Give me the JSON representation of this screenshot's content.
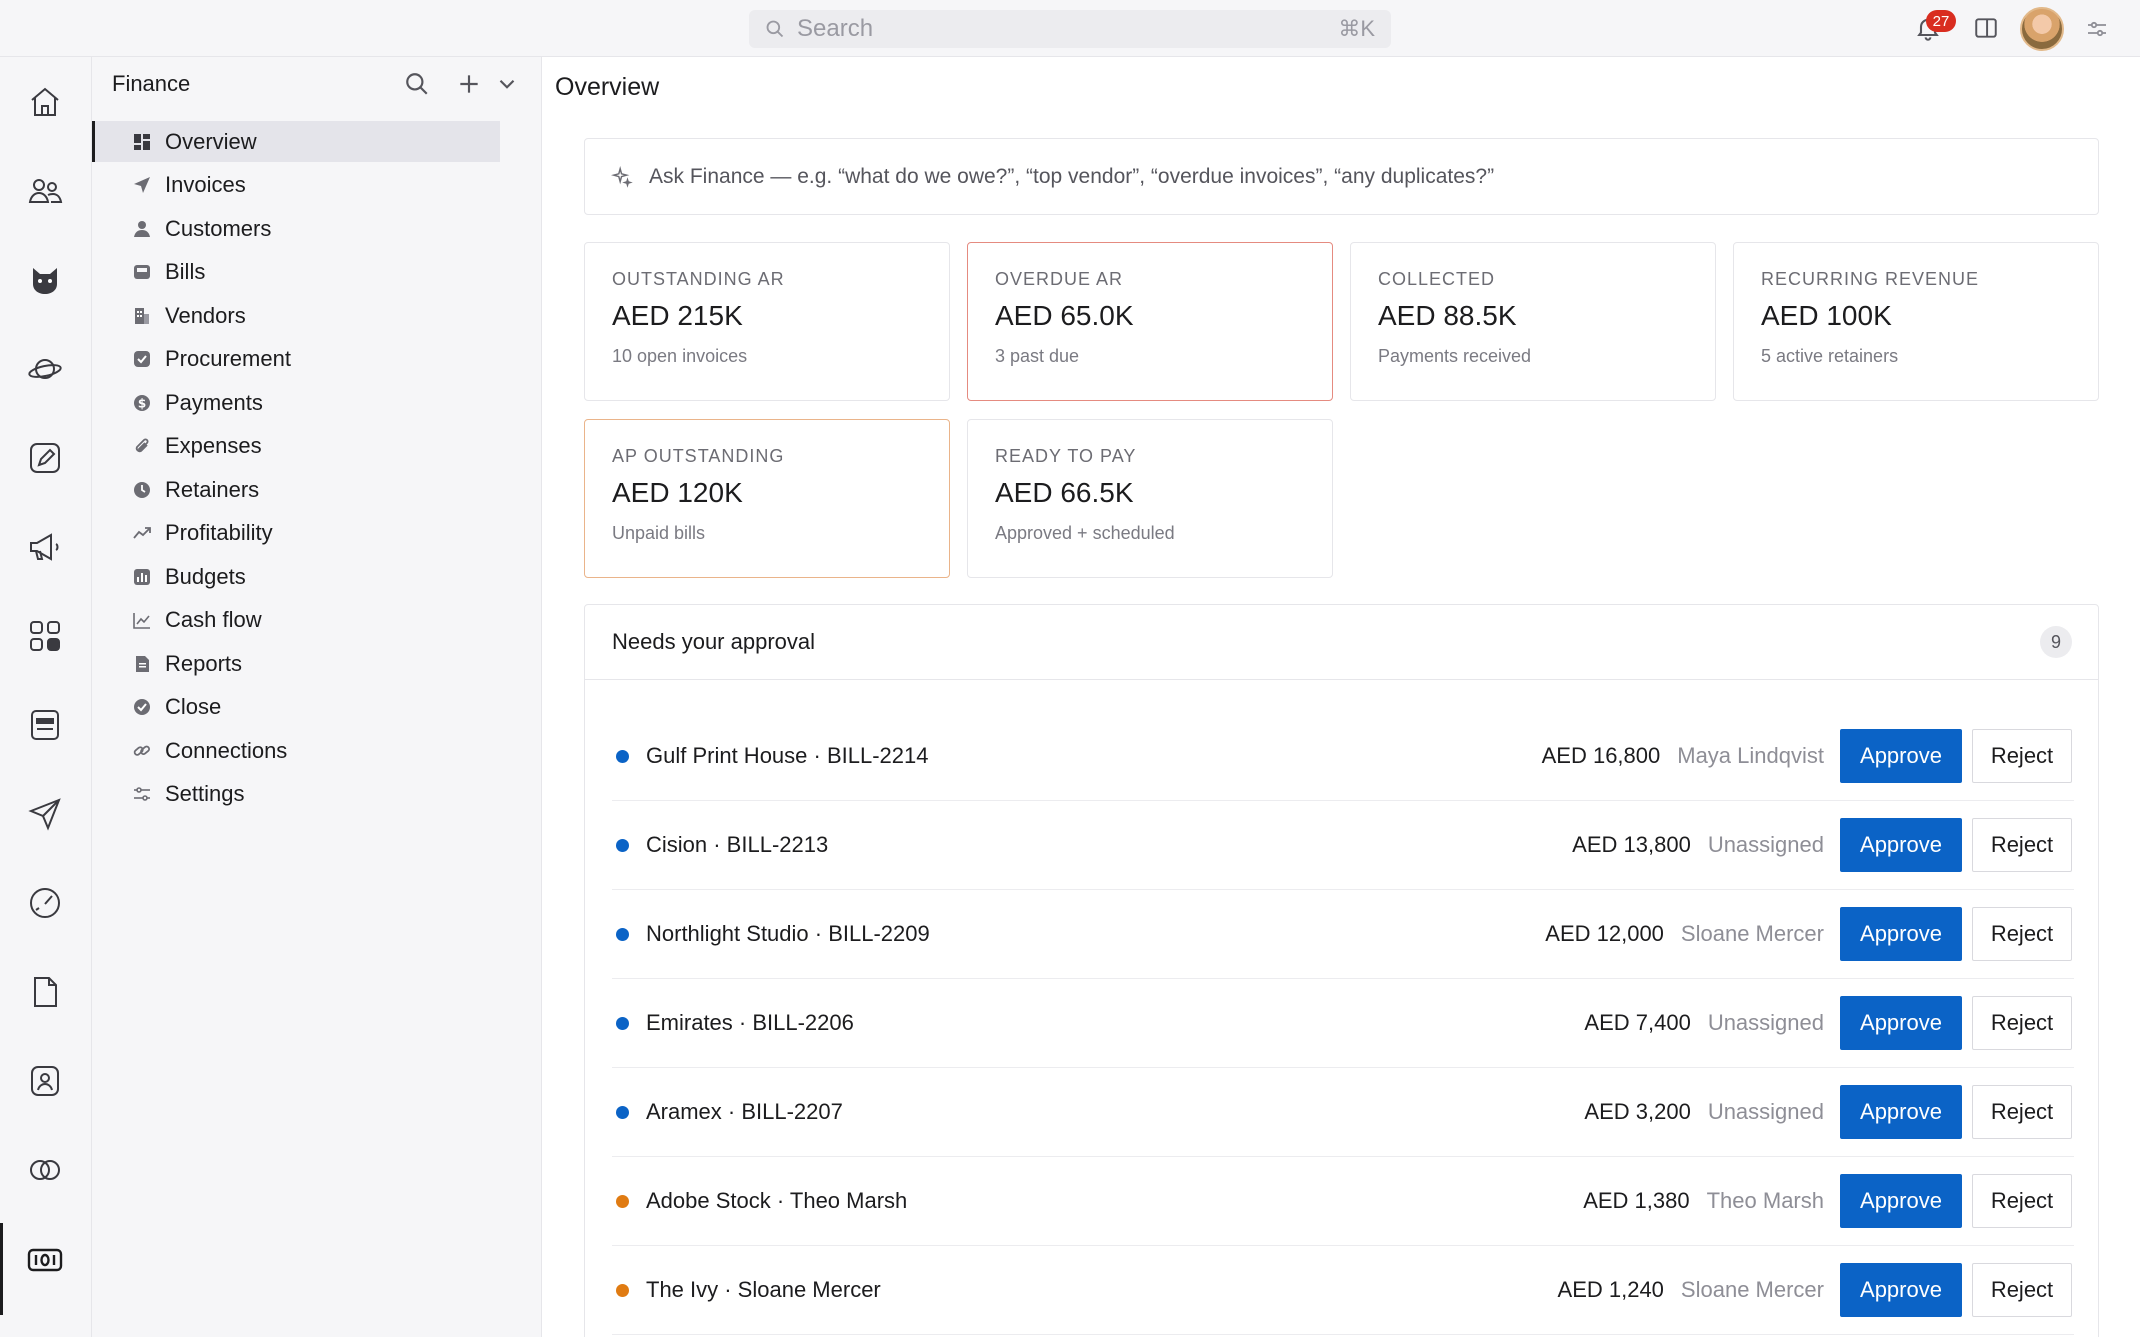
{
  "topbar": {
    "search_placeholder": "Search",
    "search_shortcut": "⌘K",
    "notification_count": "27",
    "icons": [
      "search-icon",
      "bell-icon",
      "panel-icon",
      "avatar",
      "sliders-icon"
    ]
  },
  "rail": {
    "icons": [
      "home-icon",
      "people-icon",
      "cat-icon",
      "planet-icon",
      "pen-icon",
      "megaphone-icon",
      "grid-icon",
      "inbox-icon",
      "send-icon",
      "gauge-icon",
      "document-icon",
      "contact-icon",
      "rings-icon",
      "finance-icon"
    ],
    "active": "finance-icon"
  },
  "nav": {
    "title": "Finance",
    "items": [
      {
        "label": "Overview",
        "icon": "overview-icon",
        "active": true
      },
      {
        "label": "Invoices",
        "icon": "send-icon"
      },
      {
        "label": "Customers",
        "icon": "person-icon"
      },
      {
        "label": "Bills",
        "icon": "tray-icon"
      },
      {
        "label": "Vendors",
        "icon": "building-icon"
      },
      {
        "label": "Procurement",
        "icon": "check-square-icon"
      },
      {
        "label": "Payments",
        "icon": "dollar-icon"
      },
      {
        "label": "Expenses",
        "icon": "paperclip-icon"
      },
      {
        "label": "Retainers",
        "icon": "clock-icon"
      },
      {
        "label": "Profitability",
        "icon": "trend-icon"
      },
      {
        "label": "Budgets",
        "icon": "bar-chart-icon"
      },
      {
        "label": "Cash flow",
        "icon": "line-chart-icon"
      },
      {
        "label": "Reports",
        "icon": "report-icon"
      },
      {
        "label": "Close",
        "icon": "check-circle-icon"
      },
      {
        "label": "Connections",
        "icon": "link-icon"
      },
      {
        "label": "Settings",
        "icon": "sliders-icon"
      }
    ]
  },
  "main": {
    "title": "Overview",
    "ask_placeholder": "Ask Finance — e.g. “what do we owe?”, “top vendor”, “overdue invoices”, “any duplicates?”",
    "cards": [
      {
        "label": "OUTSTANDING AR",
        "value": "AED 215K",
        "sub": "10 open invoices",
        "accent": "none"
      },
      {
        "label": "OVERDUE AR",
        "value": "AED 65.0K",
        "sub": "3 past due",
        "accent": "#e58b80"
      },
      {
        "label": "COLLECTED",
        "value": "AED 88.5K",
        "sub": "Payments received",
        "accent": "none"
      },
      {
        "label": "RECURRING REVENUE",
        "value": "AED 100K",
        "sub": "5 active retainers",
        "accent": "none"
      },
      {
        "label": "AP OUTSTANDING",
        "value": "AED 120K",
        "sub": "Unpaid bills",
        "accent": "#eab48a"
      },
      {
        "label": "READY TO PAY",
        "value": "AED 66.5K",
        "sub": "Approved + scheduled",
        "accent": "none"
      }
    ],
    "approvals": {
      "title": "Needs your approval",
      "count": "9",
      "approve_label": "Approve",
      "reject_label": "Reject",
      "rows": [
        {
          "title": "Gulf Print House · BILL-2214",
          "amount": "AED 16,800",
          "assignee": "Maya Lindqvist",
          "dot": "#0b63c6"
        },
        {
          "title": "Cision · BILL-2213",
          "amount": "AED 13,800",
          "assignee": "Unassigned",
          "dot": "#0b63c6"
        },
        {
          "title": "Northlight Studio · BILL-2209",
          "amount": "AED 12,000",
          "assignee": "Sloane Mercer",
          "dot": "#0b63c6"
        },
        {
          "title": "Emirates · BILL-2206",
          "amount": "AED 7,400",
          "assignee": "Unassigned",
          "dot": "#0b63c6"
        },
        {
          "title": "Aramex · BILL-2207",
          "amount": "AED 3,200",
          "assignee": "Unassigned",
          "dot": "#0b63c6"
        },
        {
          "title": "Adobe Stock · Theo Marsh",
          "amount": "AED 1,380",
          "assignee": "Theo Marsh",
          "dot": "#e07b12"
        },
        {
          "title": "The Ivy · Sloane Mercer",
          "amount": "AED 1,240",
          "assignee": "Sloane Mercer",
          "dot": "#e07b12"
        }
      ]
    }
  }
}
